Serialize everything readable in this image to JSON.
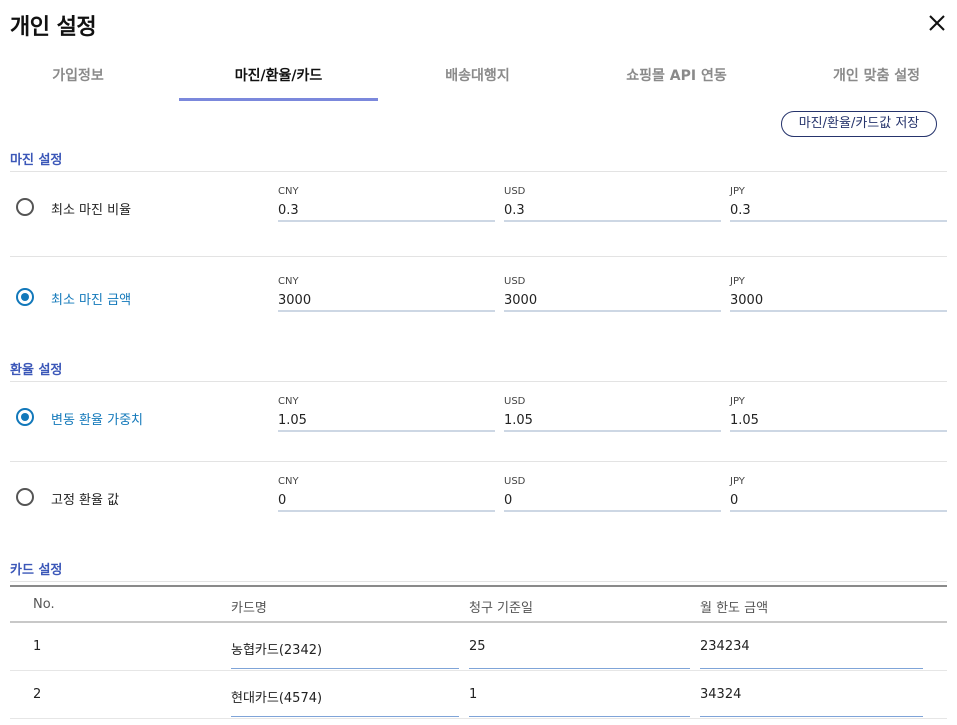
{
  "window": {
    "title": "개인 설정",
    "close_icon": "close-icon"
  },
  "tabs": [
    {
      "label": "가입정보",
      "active": false
    },
    {
      "label": "마진/환율/카드",
      "active": true
    },
    {
      "label": "배송대행지",
      "active": false
    },
    {
      "label": "쇼핑몰 API 연동",
      "active": false
    },
    {
      "label": "개인 맞춤 설정",
      "active": false
    }
  ],
  "save_button": "마진/환율/카드값 저장",
  "margin": {
    "title": "마진 설정",
    "options": [
      {
        "label": "최소 마진 비율",
        "selected": false,
        "fields": [
          {
            "currency": "CNY",
            "value": "0.3"
          },
          {
            "currency": "USD",
            "value": "0.3"
          },
          {
            "currency": "JPY",
            "value": "0.3"
          }
        ]
      },
      {
        "label": "최소 마진 금액",
        "selected": true,
        "fields": [
          {
            "currency": "CNY",
            "value": "3000"
          },
          {
            "currency": "USD",
            "value": "3000"
          },
          {
            "currency": "JPY",
            "value": "3000"
          }
        ]
      }
    ]
  },
  "exchange": {
    "title": "환율 설정",
    "options": [
      {
        "label": "변동 환율 가중치",
        "selected": true,
        "fields": [
          {
            "currency": "CNY",
            "value": "1.05"
          },
          {
            "currency": "USD",
            "value": "1.05"
          },
          {
            "currency": "JPY",
            "value": "1.05"
          }
        ]
      },
      {
        "label": "고정 환율 값",
        "selected": false,
        "fields": [
          {
            "currency": "CNY",
            "value": "0"
          },
          {
            "currency": "USD",
            "value": "0"
          },
          {
            "currency": "JPY",
            "value": "0"
          }
        ]
      }
    ]
  },
  "cards": {
    "title": "카드 설정",
    "columns": [
      "No.",
      "카드명",
      "청구 기준일",
      "월 한도 금액"
    ],
    "rows": [
      {
        "no": "1",
        "name": "농협카드(2342)",
        "billing_day": "25",
        "limit": "234234"
      },
      {
        "no": "2",
        "name": "현대카드(4574)",
        "billing_day": "1",
        "limit": "34324"
      }
    ]
  },
  "colors": {
    "accent": "#1278ba",
    "section": "#3b57b8",
    "tab_underline": "#7b88dc",
    "button_border": "#26346c"
  }
}
